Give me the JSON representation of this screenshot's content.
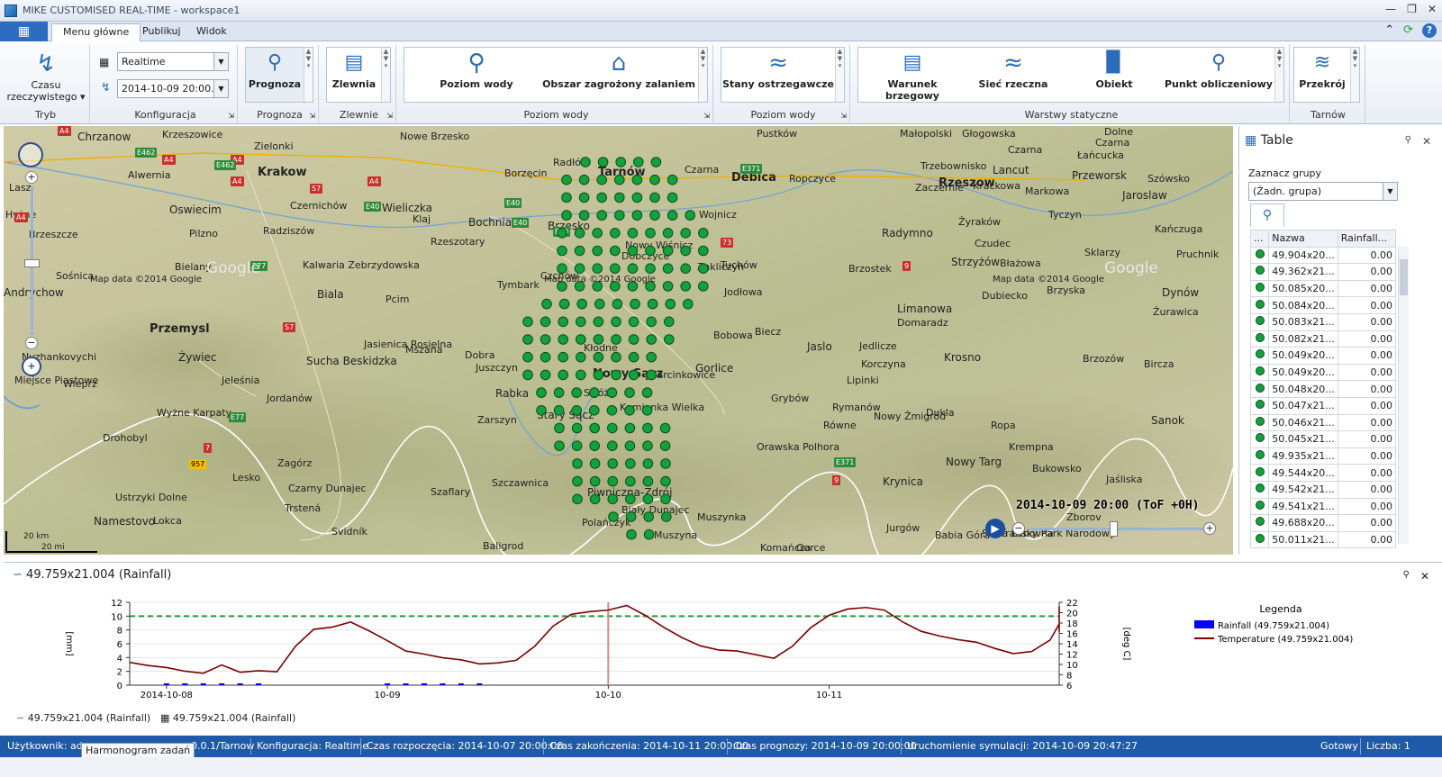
{
  "window": {
    "title": "MIKE CUSTOMISED REAL-TIME - workspace1"
  },
  "tabs": [
    {
      "label": "Menu główne"
    },
    {
      "label": "Publikuj"
    },
    {
      "label": "Widok"
    }
  ],
  "ribbon": {
    "tryb": {
      "button": "Czasu rzeczywistego",
      "label": "Tryb"
    },
    "konfiguracja": {
      "mode": "Realtime",
      "date": "2014-10-09 20:00...",
      "label": "Konfiguracja"
    },
    "prognoza": {
      "button": "Prognoza",
      "label": "Prognoza"
    },
    "zlewnie": {
      "button": "Zlewnia",
      "label": "Zlewnie"
    },
    "poziom_wody": {
      "buttons": [
        "Poziom wody",
        "Obszar zagrożony zalaniem"
      ],
      "label": "Poziom wody"
    },
    "poziom_wody2": {
      "button": "Stany ostrzegawcze",
      "label": "Poziom wody"
    },
    "warstwy": {
      "buttons": [
        "Warunek brzegowy",
        "Sieć rzeczna",
        "Obiekt",
        "Punkt obliczeniowy"
      ],
      "label": "Warstwy statyczne"
    },
    "tarnow": {
      "button": "Przekrój",
      "label": "Tarnów"
    }
  },
  "map": {
    "time": "2014-10-09 20:00 (ToF +0H)",
    "attribution": [
      "Map data ©2014 Google",
      "Map data ©2014 Google",
      "Map data ©2014 Google"
    ],
    "google": [
      "Google",
      "Google",
      "Google"
    ],
    "scale": [
      "20 km",
      "20 mi"
    ],
    "labels": [
      {
        "t": "Chrzanow",
        "c": "med"
      },
      {
        "t": "Krzeszowice",
        "c": ""
      },
      {
        "t": "Zielonki",
        "c": ""
      },
      {
        "t": "Krakow",
        "c": "big"
      },
      {
        "t": "Alwernia",
        "c": ""
      },
      {
        "t": "Nowe Brzesko",
        "c": ""
      },
      {
        "t": "Borzęcin",
        "c": ""
      },
      {
        "t": "Radłów",
        "c": ""
      },
      {
        "t": "Tarnów",
        "c": "big"
      },
      {
        "t": "Czarna",
        "c": ""
      },
      {
        "t": "Pustków",
        "c": ""
      },
      {
        "t": "Debica",
        "c": "big"
      },
      {
        "t": "Ropczyce",
        "c": ""
      },
      {
        "t": "Małopolski",
        "c": ""
      },
      {
        "t": "Głogowska",
        "c": ""
      },
      {
        "t": "Czarna",
        "c": ""
      },
      {
        "t": "Dolne",
        "c": ""
      },
      {
        "t": "Czarna",
        "c": ""
      },
      {
        "t": "Łańcucka",
        "c": ""
      },
      {
        "t": "Rzeszow",
        "c": "big"
      },
      {
        "t": "Trzebownisko",
        "c": ""
      },
      {
        "t": "Lancut",
        "c": "med"
      },
      {
        "t": "Przeworsk",
        "c": "med"
      },
      {
        "t": "Szówsko",
        "c": ""
      },
      {
        "t": "Zaczernie",
        "c": ""
      },
      {
        "t": "Krackowa",
        "c": ""
      },
      {
        "t": "Markowa",
        "c": ""
      },
      {
        "t": "Jaroslaw",
        "c": "med"
      },
      {
        "t": "Lasz",
        "c": ""
      },
      {
        "t": "Oswiecim",
        "c": "med"
      },
      {
        "t": "Czernichów",
        "c": ""
      },
      {
        "t": "Wieliczka",
        "c": "med"
      },
      {
        "t": "Klaj",
        "c": ""
      },
      {
        "t": "Bochnia",
        "c": "med"
      },
      {
        "t": "Brzesko",
        "c": "med"
      },
      {
        "t": "Wojnicz",
        "c": ""
      },
      {
        "t": "Pilzno",
        "c": ""
      },
      {
        "t": "Radziszów",
        "c": ""
      },
      {
        "t": "Rzeszotary",
        "c": ""
      },
      {
        "t": "Nowy Wiśnicz",
        "c": ""
      },
      {
        "t": "Żyraków",
        "c": ""
      },
      {
        "t": "Tyczyn",
        "c": ""
      },
      {
        "t": "Kańczuga",
        "c": ""
      },
      {
        "t": "Radymno",
        "c": "med"
      },
      {
        "t": "Czudec",
        "c": ""
      },
      {
        "t": "Hyżne",
        "c": ""
      },
      {
        "t": "Brzeszcze",
        "c": ""
      },
      {
        "t": "Bielany",
        "c": ""
      },
      {
        "t": "Kalwaria Zebrzydowska",
        "c": ""
      },
      {
        "t": "Dobczyce",
        "c": ""
      },
      {
        "t": "Tuchów",
        "c": ""
      },
      {
        "t": "Brzostek",
        "c": ""
      },
      {
        "t": "Strzyżów",
        "c": "med"
      },
      {
        "t": "Błażowa",
        "c": ""
      },
      {
        "t": "Sklarzy",
        "c": ""
      },
      {
        "t": "Pruchnik",
        "c": ""
      },
      {
        "t": "Sośnica",
        "c": ""
      },
      {
        "t": "Andrychow",
        "c": "med"
      },
      {
        "t": "Biala",
        "c": "med"
      },
      {
        "t": "Pcim",
        "c": ""
      },
      {
        "t": "Tymbark",
        "c": ""
      },
      {
        "t": "Czchów",
        "c": ""
      },
      {
        "t": "Zakliczyn",
        "c": ""
      },
      {
        "t": "Jodłowa",
        "c": ""
      },
      {
        "t": "Brzyska",
        "c": ""
      },
      {
        "t": "Dubiecko",
        "c": ""
      },
      {
        "t": "Dynów",
        "c": "med"
      },
      {
        "t": "Żurawica",
        "c": ""
      },
      {
        "t": "Przemysl",
        "c": "big"
      },
      {
        "t": "Sucha Beskidzka",
        "c": "med"
      },
      {
        "t": "Mszana",
        "c": ""
      },
      {
        "t": "Limanowa",
        "c": "med"
      },
      {
        "t": "Domaradz",
        "c": ""
      },
      {
        "t": "Jasienica Rosielna",
        "c": ""
      },
      {
        "t": "Dobra",
        "c": ""
      },
      {
        "t": "Kłodne",
        "c": ""
      },
      {
        "t": "Bobowa",
        "c": ""
      },
      {
        "t": "Biecz",
        "c": ""
      },
      {
        "t": "Jaslo",
        "c": "med"
      },
      {
        "t": "Jedlicze",
        "c": ""
      },
      {
        "t": "Korczyna",
        "c": ""
      },
      {
        "t": "Krosno",
        "c": "med"
      },
      {
        "t": "Brzozów",
        "c": ""
      },
      {
        "t": "Bircza",
        "c": ""
      },
      {
        "t": "Nyzhankovychi",
        "c": ""
      },
      {
        "t": "Żywiec",
        "c": "med"
      },
      {
        "t": "Juszczyn",
        "c": ""
      },
      {
        "t": "Marcinkowice",
        "c": ""
      },
      {
        "t": "Gorlice",
        "c": "med"
      },
      {
        "t": "Lipinki",
        "c": ""
      },
      {
        "t": "Miejsce Piastowe",
        "c": ""
      },
      {
        "t": "Wieprz",
        "c": ""
      },
      {
        "t": "Jeleśnia",
        "c": ""
      },
      {
        "t": "Jordanów",
        "c": ""
      },
      {
        "t": "Rabka",
        "c": "med"
      },
      {
        "t": "Nowy Sącz",
        "c": "big"
      },
      {
        "t": "Stróże",
        "c": ""
      },
      {
        "t": "Grybów",
        "c": ""
      },
      {
        "t": "Nowy Żmigród",
        "c": ""
      },
      {
        "t": "Rymanów",
        "c": ""
      },
      {
        "t": "Równe",
        "c": ""
      },
      {
        "t": "Dukla",
        "c": ""
      },
      {
        "t": "Zarszyn",
        "c": ""
      },
      {
        "t": "Stary Sącz",
        "c": "med"
      },
      {
        "t": "Kamionka Wielka",
        "c": ""
      },
      {
        "t": "Ropa",
        "c": ""
      },
      {
        "t": "Sanok",
        "c": "med"
      },
      {
        "t": "Drohobyl",
        "c": ""
      },
      {
        "t": "Orawska Polhora",
        "c": ""
      },
      {
        "t": "Krempna",
        "c": ""
      },
      {
        "t": "Zagórz",
        "c": ""
      },
      {
        "t": "Nowy Targ",
        "c": "med"
      },
      {
        "t": "Bukowsko",
        "c": ""
      },
      {
        "t": "Lesko",
        "c": ""
      },
      {
        "t": "Czarny Dunajec",
        "c": ""
      },
      {
        "t": "Szaflary",
        "c": ""
      },
      {
        "t": "Szczawnica",
        "c": ""
      },
      {
        "t": "Piwniczna-Zdrój",
        "c": "med"
      },
      {
        "t": "Krynica",
        "c": "med"
      },
      {
        "t": "Jaśliska",
        "c": ""
      },
      {
        "t": "Ustrzyki Dolne",
        "c": ""
      },
      {
        "t": "Namestovo",
        "c": "med"
      },
      {
        "t": "Lokca",
        "c": ""
      },
      {
        "t": "Trstená",
        "c": ""
      },
      {
        "t": "Biały Dunajec",
        "c": ""
      },
      {
        "t": "Muszynka",
        "c": ""
      },
      {
        "t": "Zborov",
        "c": ""
      },
      {
        "t": "Polańczyk",
        "c": ""
      },
      {
        "t": "Muszyna",
        "c": ""
      },
      {
        "t": "Jurgów",
        "c": ""
      },
      {
        "t": "Stará Ľubovňa",
        "c": ""
      },
      {
        "t": "Komańcza",
        "c": ""
      },
      {
        "t": "Baligrod",
        "c": ""
      },
      {
        "t": "Svidník",
        "c": ""
      },
      {
        "t": "Babia Góra",
        "c": ""
      },
      {
        "t": "Tatranský Park Narodowy",
        "c": ""
      },
      {
        "t": "Gorce",
        "c": ""
      },
      {
        "t": "Wyżne Karpaty",
        "c": ""
      }
    ],
    "roads": [
      {
        "t": "A4",
        "c": "r"
      },
      {
        "t": "A4",
        "c": "r"
      },
      {
        "t": "A4",
        "c": "r"
      },
      {
        "t": "A4",
        "c": "r"
      },
      {
        "t": "A4",
        "c": "r"
      },
      {
        "t": "A4",
        "c": "r"
      },
      {
        "t": "E462",
        "c": "g"
      },
      {
        "t": "E462",
        "c": "g"
      },
      {
        "t": "E40",
        "c": "g"
      },
      {
        "t": "E40",
        "c": "g"
      },
      {
        "t": "E40",
        "c": "g"
      },
      {
        "t": "E40",
        "c": "g"
      },
      {
        "t": "S7",
        "c": "r"
      },
      {
        "t": "E77",
        "c": "g"
      },
      {
        "t": "E77",
        "c": "g"
      },
      {
        "t": "73",
        "c": "r"
      },
      {
        "t": "9",
        "c": "r"
      },
      {
        "t": "9",
        "c": "r"
      },
      {
        "t": "7",
        "c": "r"
      },
      {
        "t": "957",
        "c": "y"
      },
      {
        "t": "E371",
        "c": "g"
      },
      {
        "t": "E371",
        "c": "g"
      },
      {
        "t": "S7",
        "c": "r"
      }
    ]
  },
  "table_pane": {
    "title": "Table",
    "group_label": "Zaznacz grupy",
    "group_value": "(Żadn. grupa)",
    "columns": [
      "...",
      "Nazwa",
      "Rainfall..."
    ],
    "rows": [
      {
        "name": "49.904x20...",
        "value": "0.00"
      },
      {
        "name": "49.362x21...",
        "value": "0.00"
      },
      {
        "name": "50.085x20...",
        "value": "0.00"
      },
      {
        "name": "50.084x20...",
        "value": "0.00"
      },
      {
        "name": "50.083x21...",
        "value": "0.00"
      },
      {
        "name": "50.082x21...",
        "value": "0.00"
      },
      {
        "name": "50.049x20...",
        "value": "0.00"
      },
      {
        "name": "50.049x20...",
        "value": "0.00"
      },
      {
        "name": "50.048x20...",
        "value": "0.00"
      },
      {
        "name": "50.047x21...",
        "value": "0.00"
      },
      {
        "name": "50.046x21...",
        "value": "0.00"
      },
      {
        "name": "50.045x21...",
        "value": "0.00"
      },
      {
        "name": "49.935x21...",
        "value": "0.00"
      },
      {
        "name": "49.544x20...",
        "value": "0.00"
      },
      {
        "name": "49.542x21...",
        "value": "0.00"
      },
      {
        "name": "49.541x21...",
        "value": "0.00"
      },
      {
        "name": "49.688x20...",
        "value": "0.00"
      },
      {
        "name": "50.011x21...",
        "value": "0.00"
      }
    ]
  },
  "chart_pane": {
    "title": "49.759x21.004 (Rainfall)",
    "tabs": [
      "49.759x21.004 (Rainfall)",
      "49.759x21.004 (Rainfall)"
    ]
  },
  "chart_data": {
    "type": "line",
    "xlabel": "",
    "ylabel": "[mm]",
    "y2label": "[deg C]",
    "ylim": [
      0,
      12
    ],
    "y2lim": [
      6,
      22
    ],
    "yticks": [
      0,
      2,
      4,
      6,
      8,
      10,
      12
    ],
    "y2ticks": [
      6,
      8,
      10,
      12,
      14,
      16,
      18,
      20,
      22
    ],
    "x_ticks": [
      "2014-10-08",
      "10-09",
      "10-10",
      "10-11"
    ],
    "x_tick_hours": [
      0,
      24,
      48,
      72
    ],
    "xlim_hours": [
      -4,
      97
    ],
    "current_time_hours": 48,
    "threshold": {
      "value": 10,
      "axis": "left"
    },
    "legend_title": "Legenda",
    "legend_position": "right",
    "series": [
      {
        "name": "Rainfall (49.759x21.004)",
        "axis": "left",
        "color": "#0000ff",
        "x_hours": [
          0,
          2,
          4,
          6,
          8,
          10,
          24,
          26,
          28,
          30,
          32,
          34
        ],
        "values": [
          0,
          0,
          0,
          0,
          0,
          0,
          0,
          0,
          0,
          0,
          0,
          0
        ]
      },
      {
        "name": "Temperature (49.759x21.004)",
        "axis": "right",
        "color": "#7a0000",
        "x_hours": [
          -4,
          -2,
          0,
          2,
          4,
          6,
          7,
          8,
          10,
          12,
          14,
          16,
          18,
          20,
          22,
          24,
          26,
          28,
          30,
          32,
          34,
          36,
          38,
          40,
          42,
          44,
          46,
          48,
          50,
          52,
          54,
          56,
          58,
          60,
          62,
          64,
          66,
          68,
          70,
          72,
          74,
          76,
          78,
          80,
          82,
          84,
          86,
          88,
          90,
          92,
          94,
          96
        ],
        "values": [
          10.4,
          9.8,
          9.4,
          8.7,
          8.3,
          9.9,
          9.2,
          8.5,
          8.8,
          8.6,
          13.5,
          16.8,
          17.2,
          18.2,
          16.5,
          14.6,
          12.6,
          12.0,
          11.3,
          10.9,
          10.1,
          10.3,
          10.8,
          13.5,
          17.4,
          19.7,
          20.2,
          20.5,
          21.4,
          19.5,
          17.2,
          15.2,
          13.6,
          12.8,
          12.6,
          11.9,
          11.2,
          13.5,
          17.1,
          19.5,
          20.7,
          21.0,
          20.5,
          18.2,
          16.4,
          15.5,
          14.8,
          14.3,
          13.1,
          12.1,
          12.5,
          14.7,
          17.8,
          20.4,
          21.2,
          20.3,
          17.8,
          16.8,
          16.3
        ]
      }
    ]
  },
  "status": {
    "user": "Użytkownik: adm",
    "server": "0.0.1/Tarnow",
    "config": "Konfiguracja: Realtime",
    "start": "Czas rozpoczęcia: 2014-10-07 20:00:00",
    "end": "Czas zakończenia: 2014-10-11 20:00:00",
    "forecast": "Czas prognozy: 2014-10-09 20:00:00",
    "run": "Uruchomienie symulacji: 2014-10-09 20:47:27",
    "ready": "Gotowy",
    "count": "Liczba: 1",
    "tooltip": "Harmonogram zadań"
  },
  "colors": {
    "accent": "#2e6cc0",
    "status": "#1f5aa8",
    "dot": "#12a13a",
    "temp": "#7a0000",
    "threshold": "#1a9c3c"
  }
}
